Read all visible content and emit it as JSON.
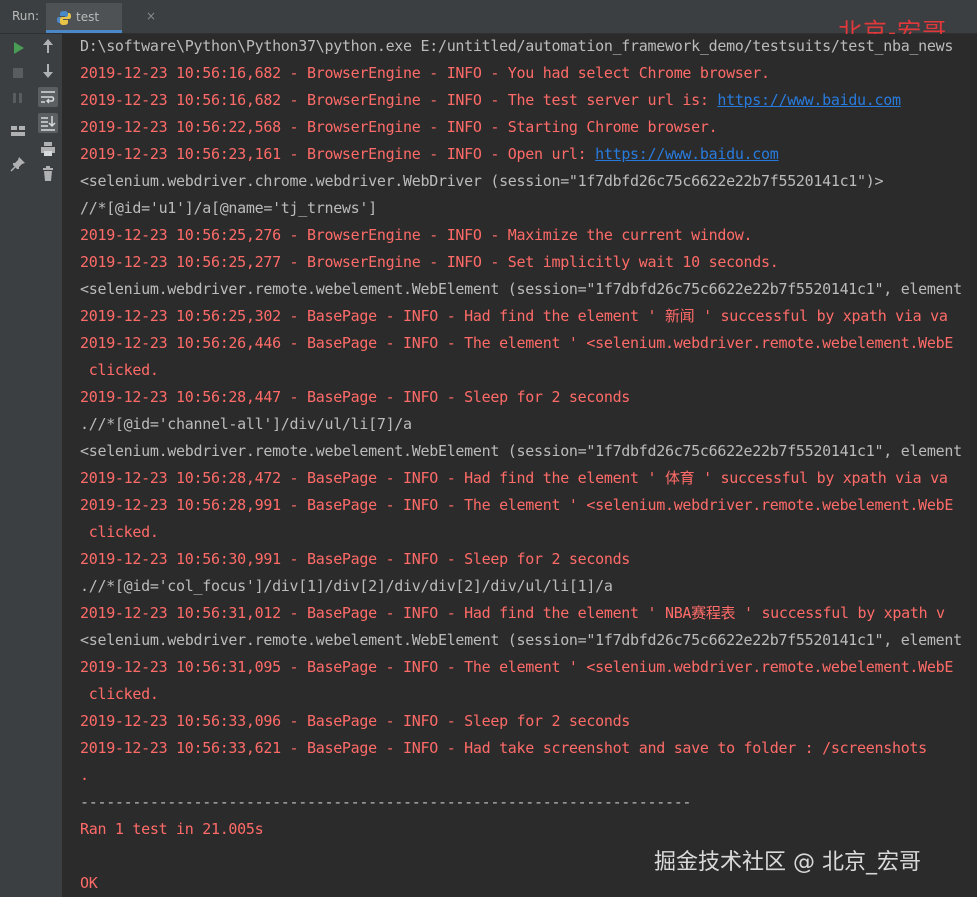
{
  "tabbar": {
    "run_label": "Run:",
    "tab_label": "test",
    "tab_close": "×"
  },
  "watermark_top": "北京-宏哥",
  "watermark_bottom": "掘金技术社区 @ 北京_宏哥",
  "toolbar": {
    "left": [
      "play-icon",
      "stop-icon",
      "pause-icon",
      "layout-icon",
      "pin-icon"
    ],
    "right": [
      "arrow-up-icon",
      "arrow-down-icon",
      "wrap-icon",
      "scroll-end-icon",
      "print-icon",
      "trash-icon"
    ]
  },
  "console": {
    "lines": [
      {
        "color": "white",
        "text": "D:\\software\\Python\\Python37\\python.exe E:/untitled/automation_framework_demo/testsuits/test_nba_news"
      },
      {
        "color": "red",
        "text": "2019-12-23 10:56:16,682 - BrowserEngine - INFO - You had select Chrome browser."
      },
      {
        "color": "red",
        "text": "2019-12-23 10:56:16,682 - BrowserEngine - INFO - The test server url is: ",
        "link": "https://www.baidu.com"
      },
      {
        "color": "red",
        "text": "2019-12-23 10:56:22,568 - BrowserEngine - INFO - Starting Chrome browser."
      },
      {
        "color": "red",
        "text": "2019-12-23 10:56:23,161 - BrowserEngine - INFO - Open url: ",
        "link": "https://www.baidu.com"
      },
      {
        "color": "white",
        "text": "<selenium.webdriver.chrome.webdriver.WebDriver (session=\"1f7dbfd26c75c6622e22b7f5520141c1\")>"
      },
      {
        "color": "white",
        "text": "//*[@id='u1']/a[@name='tj_trnews']"
      },
      {
        "color": "red",
        "text": "2019-12-23 10:56:25,276 - BrowserEngine - INFO - Maximize the current window."
      },
      {
        "color": "red",
        "text": "2019-12-23 10:56:25,277 - BrowserEngine - INFO - Set implicitly wait 10 seconds."
      },
      {
        "color": "white",
        "text": "<selenium.webdriver.remote.webelement.WebElement (session=\"1f7dbfd26c75c6622e22b7f5520141c1\", element"
      },
      {
        "color": "red",
        "text": "2019-12-23 10:56:25,302 - BasePage - INFO - Had find the element ' 新闻 ' successful by xpath via va"
      },
      {
        "color": "red",
        "text": "2019-12-23 10:56:26,446 - BasePage - INFO - The element ' <selenium.webdriver.remote.webelement.WebE"
      },
      {
        "color": "red",
        "text": " clicked."
      },
      {
        "color": "red",
        "text": "2019-12-23 10:56:28,447 - BasePage - INFO - Sleep for 2 seconds"
      },
      {
        "color": "white",
        "text": ".//*[@id='channel-all']/div/ul/li[7]/a"
      },
      {
        "color": "white",
        "text": "<selenium.webdriver.remote.webelement.WebElement (session=\"1f7dbfd26c75c6622e22b7f5520141c1\", element"
      },
      {
        "color": "red",
        "text": "2019-12-23 10:56:28,472 - BasePage - INFO - Had find the element ' 体育 ' successful by xpath via va"
      },
      {
        "color": "red",
        "text": "2019-12-23 10:56:28,991 - BasePage - INFO - The element ' <selenium.webdriver.remote.webelement.WebE"
      },
      {
        "color": "red",
        "text": " clicked."
      },
      {
        "color": "red",
        "text": "2019-12-23 10:56:30,991 - BasePage - INFO - Sleep for 2 seconds"
      },
      {
        "color": "white",
        "text": ".//*[@id='col_focus']/div[1]/div[2]/div/div[2]/div/ul/li[1]/a"
      },
      {
        "color": "red",
        "text": "2019-12-23 10:56:31,012 - BasePage - INFO - Had find the element ' NBA赛程表 ' successful by xpath v"
      },
      {
        "color": "white",
        "text": "<selenium.webdriver.remote.webelement.WebElement (session=\"1f7dbfd26c75c6622e22b7f5520141c1\", element"
      },
      {
        "color": "red",
        "text": "2019-12-23 10:56:31,095 - BasePage - INFO - The element ' <selenium.webdriver.remote.webelement.WebE"
      },
      {
        "color": "red",
        "text": " clicked."
      },
      {
        "color": "red",
        "text": "2019-12-23 10:56:33,096 - BasePage - INFO - Sleep for 2 seconds"
      },
      {
        "color": "red",
        "text": "2019-12-23 10:56:33,621 - BasePage - INFO - Had take screenshot and save to folder : /screenshots"
      },
      {
        "color": "red",
        "text": "."
      },
      {
        "color": "sep",
        "text": "----------------------------------------------------------------------"
      },
      {
        "color": "red",
        "text": "Ran 1 test in 21.005s"
      },
      {
        "color": "red",
        "text": ""
      },
      {
        "color": "red",
        "text": "OK"
      }
    ]
  }
}
